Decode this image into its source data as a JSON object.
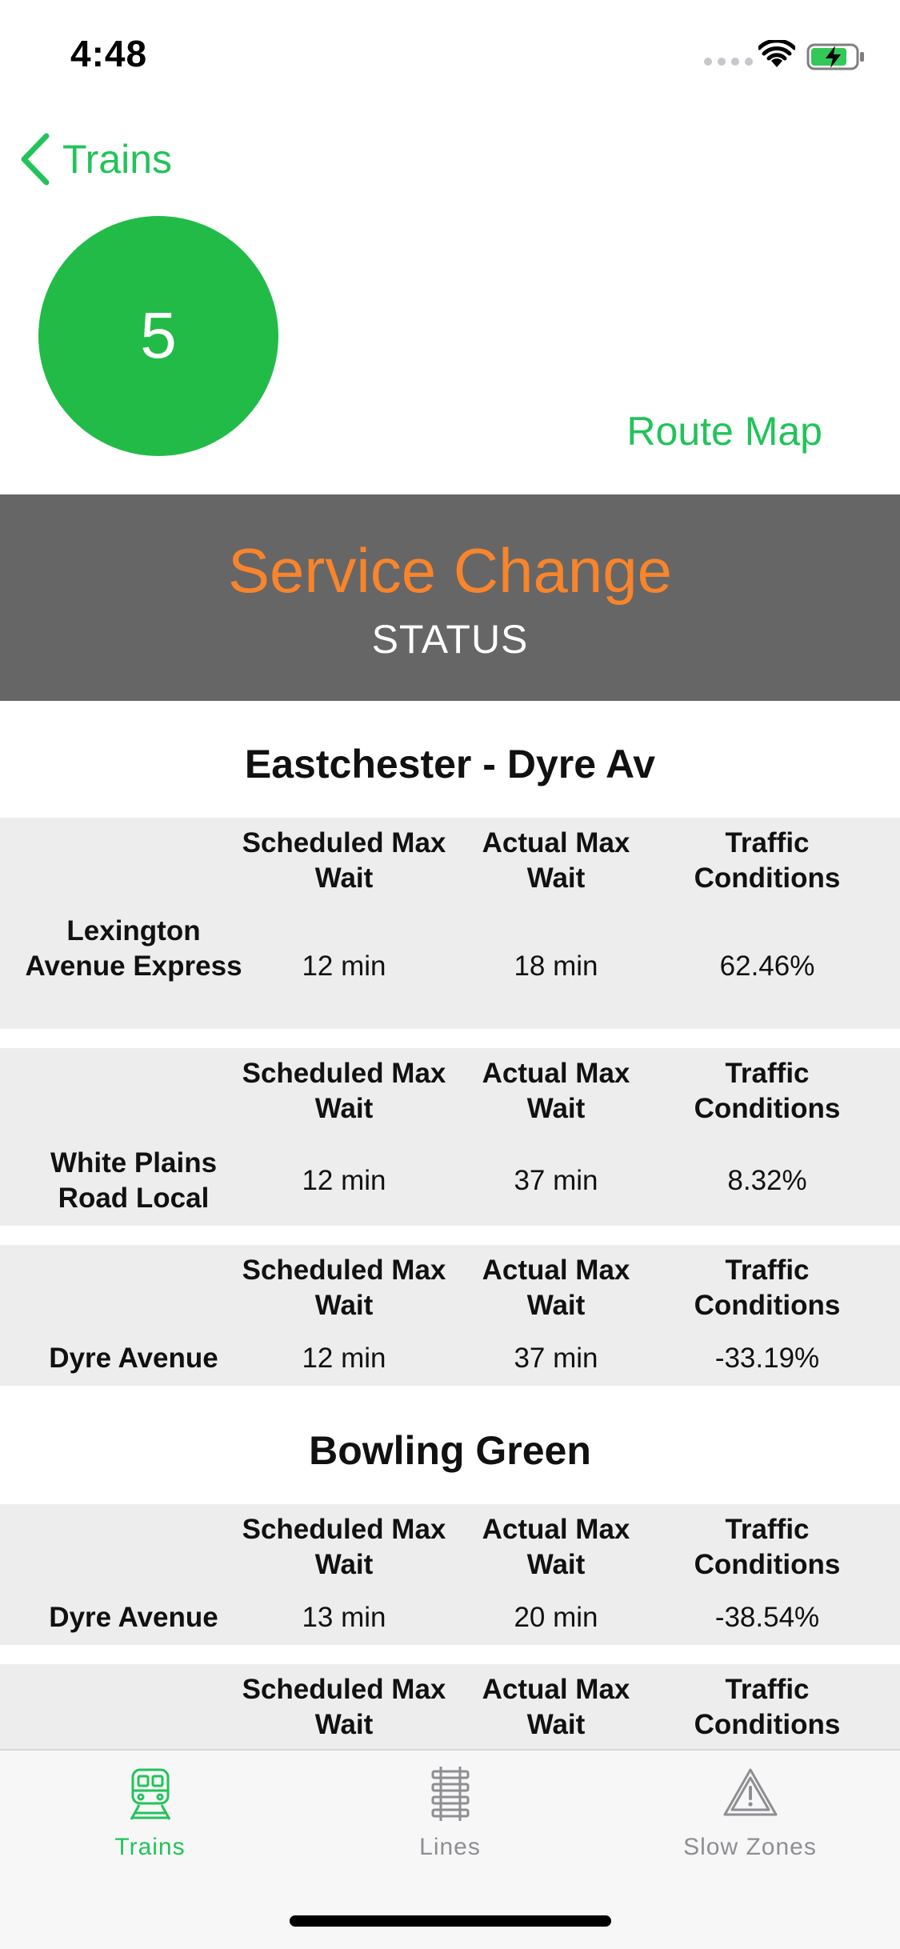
{
  "status_bar": {
    "time": "4:48"
  },
  "nav": {
    "back_label": "Trains",
    "route_number": "5",
    "route_map_label": "Route Map"
  },
  "status": {
    "title": "Service Change",
    "label": "STATUS"
  },
  "headers": {
    "scheduled": "Scheduled Max Wait",
    "actual": "Actual Max Wait",
    "traffic": "Traffic Conditions"
  },
  "sections": [
    {
      "title": "Eastchester - Dyre Av",
      "rows": [
        {
          "name": "Lexington Avenue Express",
          "scheduled": "12 min",
          "actual": "18 min",
          "traffic": "62.46%"
        },
        {
          "name": "White Plains Road Local",
          "scheduled": "12 min",
          "actual": "37 min",
          "traffic": "8.32%"
        },
        {
          "name": "Dyre Avenue",
          "scheduled": "12 min",
          "actual": "37 min",
          "traffic": "-33.19%"
        }
      ]
    },
    {
      "title": "Bowling Green",
      "rows": [
        {
          "name": "Dyre Avenue",
          "scheduled": "13 min",
          "actual": "20 min",
          "traffic": "-38.54%"
        },
        {
          "name": "",
          "scheduled": "",
          "actual": "",
          "traffic": ""
        }
      ]
    }
  ],
  "tabs": [
    {
      "label": "Trains",
      "icon": "train-icon",
      "active": true
    },
    {
      "label": "Lines",
      "icon": "rail-track-icon",
      "active": false
    },
    {
      "label": "Slow Zones",
      "icon": "warning-icon",
      "active": false
    }
  ],
  "colors": {
    "accent": "#22c35a",
    "route": "#22bb48",
    "status": "#f8842b",
    "banner": "#666666"
  }
}
